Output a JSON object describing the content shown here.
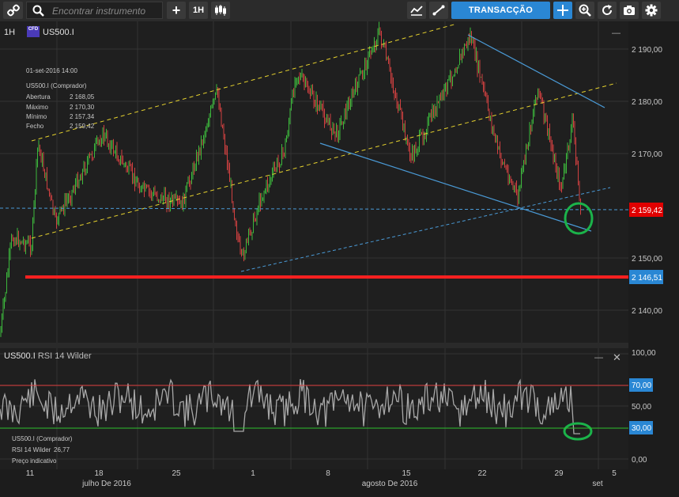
{
  "toolbar": {
    "search_placeholder": "Encontrar instrumento",
    "add_label": "+",
    "timeframe_label": "1H",
    "trade_label": "TRANSACÇÃO",
    "icons": [
      "link-icon",
      "search-icon",
      "plus-icon",
      "candlestick-icon",
      "indicator-icon",
      "line-tool-icon",
      "crosshair-icon",
      "zoom-in-icon",
      "refresh-icon",
      "camera-icon",
      "gear-icon"
    ]
  },
  "main_panel": {
    "timeframe": "1H",
    "badge": "CFD",
    "symbol": "US500.I",
    "minimize_label": "—"
  },
  "info_box": {
    "datetime": "01-set-2016 14:00",
    "title": "US500.I (Comprador)",
    "rows": [
      {
        "label": "Abertura",
        "value": "2 168,05"
      },
      {
        "label": "Máximo",
        "value": "2 170,30"
      },
      {
        "label": "Mínimo",
        "value": "2 157,34"
      },
      {
        "label": "Fecho",
        "value": "2 159,42"
      }
    ]
  },
  "price_axis": {
    "ticks": [
      "2 190,00",
      "2 180,00",
      "2 170,00",
      "2 160,00",
      "2 150,00",
      "2 140,00"
    ],
    "current_price": "2 159,42",
    "current_price_color": "#e00000",
    "level_price": "2 146,51",
    "level_color": "#ff2020",
    "level_box_color": "#2a87d4"
  },
  "rsi_panel": {
    "symbol": "US500.I",
    "indicator": "RSI 14 Wilder",
    "minimize_label": "—",
    "close_label": "✕",
    "ticks": [
      "100,00",
      "70,00",
      "50,00",
      "30,00",
      "0,00"
    ],
    "info_title": "US500.I (Comprador)",
    "info_label": "RSI 14 Wilder",
    "info_value": "26,77",
    "info_note": "Preço indicativo"
  },
  "x_axis": {
    "ticks": [
      "11",
      "18",
      "25",
      "1",
      "8",
      "15",
      "22",
      "29",
      "5"
    ],
    "month_labels": [
      "julho De 2016",
      "agosto De 2016",
      "set"
    ]
  },
  "chart_data": {
    "type": "candlestick",
    "instrument": "US500.I",
    "timeframe": "1H",
    "ylim": [
      2136,
      2196
    ],
    "current_price": 2159.42,
    "horizontal_level": 2146.51,
    "last_candle": {
      "open": 2168.05,
      "high": 2170.3,
      "low": 2157.34,
      "close": 2159.42
    },
    "rsi": {
      "name": "RSI 14 Wilder",
      "last": 26.77,
      "overbought": 70,
      "oversold": 30,
      "ylim": [
        0,
        100
      ]
    }
  }
}
